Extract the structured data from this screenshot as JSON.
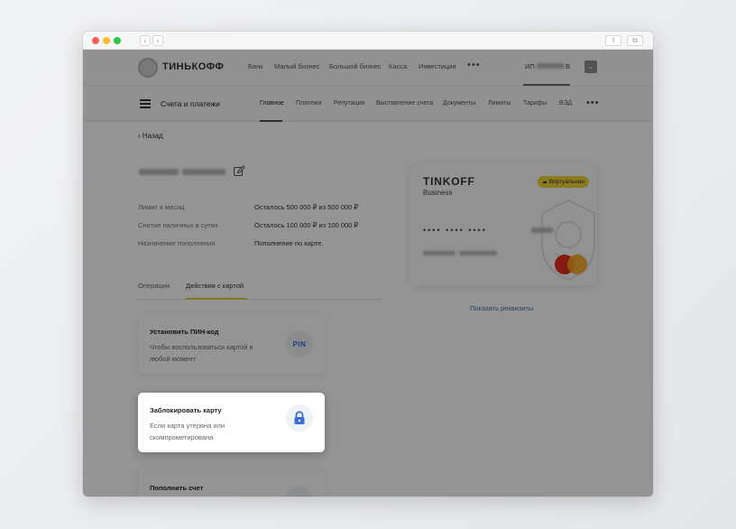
{
  "browser": {
    "back_label": "‹",
    "forward_label": "›",
    "share_label": "⇪",
    "tabs_label": "⧉"
  },
  "header": {
    "logo_text": "ТИНЬКОФФ",
    "nav": [
      "Банк",
      "Малый бизнес",
      "Большой бизнес",
      "Касса",
      "Инвестиции"
    ],
    "more": "•••",
    "account_prefix": "ИП",
    "account_suffix": "В",
    "corner_icon": "⌄"
  },
  "subheader": {
    "title": "Счета и платежи",
    "tabs": [
      "Главное",
      "Платежи",
      "Репутация",
      "Выставление счета",
      "Документы",
      "Лимиты",
      "Тарифы",
      "ВЭД"
    ],
    "more": "•••"
  },
  "back_link": "Назад",
  "card_info": {
    "rows": [
      {
        "label": "Лимит в месяц",
        "value": "Осталось 500 000 ₽ из 500 000 ₽"
      },
      {
        "label": "Снятие наличных в сутки",
        "value": "Осталось 100 000 ₽ из 100 000 ₽"
      },
      {
        "label": "Назначение пополнения",
        "value": "Пополнение по карте."
      }
    ]
  },
  "tabs": [
    "Операции",
    "Действия с картой"
  ],
  "actions": [
    {
      "title": "Установить ПИН-код",
      "desc": "Чтобы воспользоваться картой в любой момент",
      "icon": "PIN"
    },
    {
      "title": "Заблокировать карту",
      "desc": "Если карта утеряна или скомпрометирована",
      "icon": "lock-icon"
    },
    {
      "title": "Пополнить счет",
      "desc": "",
      "icon": "₽"
    }
  ],
  "bank_card": {
    "brand": "TINKOFF",
    "brand_sub": "Business",
    "badge": "Виртуальная",
    "number_mask": "•••• •••• ••••"
  },
  "show_details": "Показать реквизиты",
  "colors": {
    "accent_yellow": "#f3d438",
    "link_blue": "#4a6ea8",
    "icon_blue": "#3a6ed8"
  }
}
